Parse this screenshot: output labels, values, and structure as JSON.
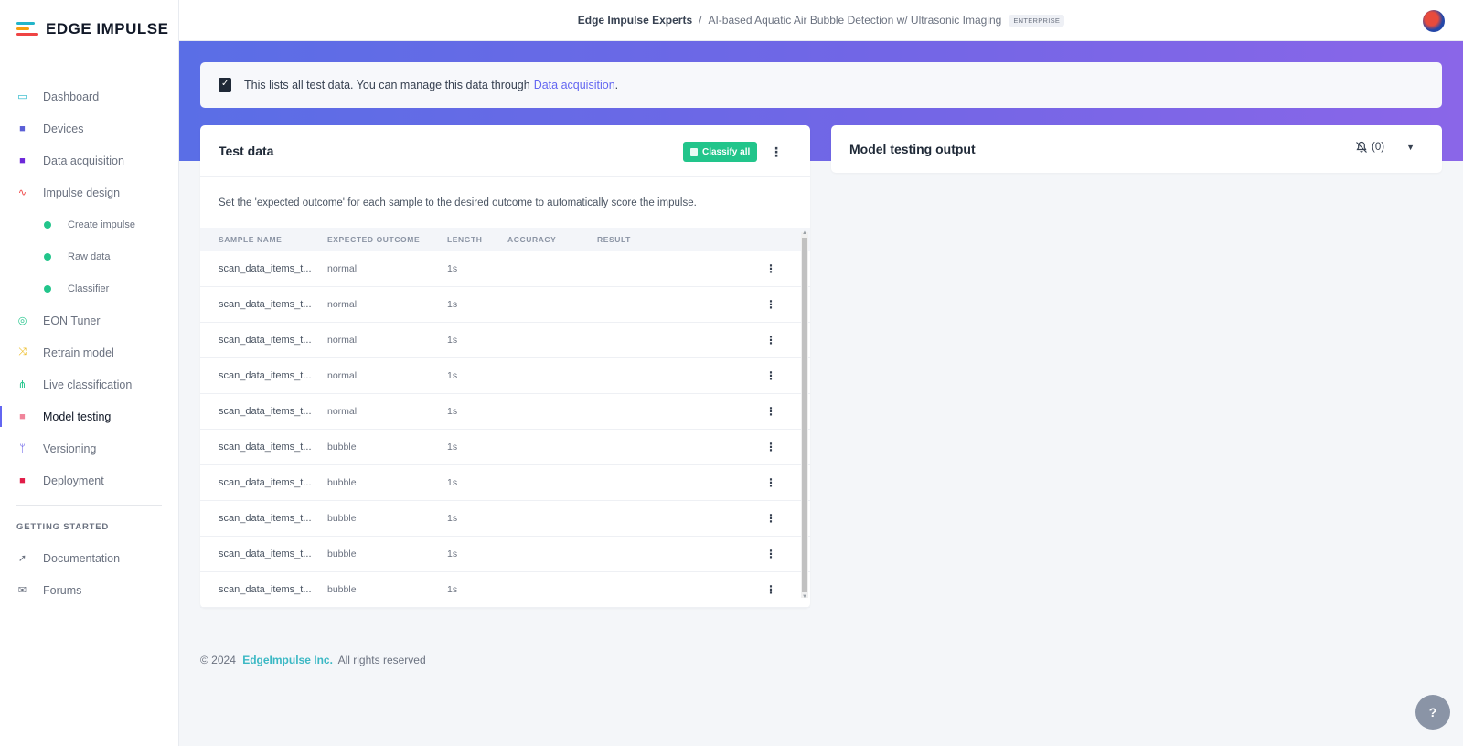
{
  "app": {
    "logo_text": "EDGE IMPULSE"
  },
  "breadcrumb": {
    "org": "Edge Impulse Experts",
    "separator": "/",
    "project": "AI-based Aquatic Air Bubble Detection w/ Ultrasonic Imaging",
    "badge": "ENTERPRISE"
  },
  "sidebar": {
    "items": [
      {
        "label": "Dashboard",
        "icon": "monitor-icon",
        "color": "#22b5c9"
      },
      {
        "label": "Devices",
        "icon": "chip-icon",
        "color": "#5b5fd6"
      },
      {
        "label": "Data acquisition",
        "icon": "database-icon",
        "color": "#6d28d9"
      },
      {
        "label": "Impulse design",
        "icon": "pulse-icon",
        "color": "#ef4444"
      }
    ],
    "sub_items": [
      {
        "label": "Create impulse"
      },
      {
        "label": "Raw data"
      },
      {
        "label": "Classifier"
      }
    ],
    "items2": [
      {
        "label": "EON Tuner",
        "icon": "compass-icon",
        "color": "#22c58b"
      },
      {
        "label": "Retrain model",
        "icon": "shuffle-icon",
        "color": "#eab308"
      },
      {
        "label": "Live classification",
        "icon": "nodes-icon",
        "color": "#22c58b"
      },
      {
        "label": "Model testing",
        "icon": "clipboard-icon",
        "color": "#f0849a",
        "active": true
      },
      {
        "label": "Versioning",
        "icon": "branch-icon",
        "color": "#4f46e5"
      },
      {
        "label": "Deployment",
        "icon": "cube-icon",
        "color": "#e11d48"
      }
    ],
    "section_title": "GETTING STARTED",
    "getting_started": [
      {
        "label": "Documentation",
        "icon": "rocket-icon"
      },
      {
        "label": "Forums",
        "icon": "chat-icon"
      }
    ]
  },
  "info": {
    "text": "This lists all test data. You can manage this data through",
    "link": "Data acquisition",
    "suffix": "."
  },
  "test_data": {
    "title": "Test data",
    "classify_label": "Classify all",
    "description": "Set the 'expected outcome' for each sample to the desired outcome to automatically score the impulse.",
    "columns": [
      "SAMPLE NAME",
      "EXPECTED OUTCOME",
      "LENGTH",
      "ACCURACY",
      "RESULT"
    ],
    "rows": [
      {
        "name": "scan_data_items_t...",
        "outcome": "normal",
        "length": "1s",
        "accuracy": "",
        "result": ""
      },
      {
        "name": "scan_data_items_t...",
        "outcome": "normal",
        "length": "1s",
        "accuracy": "",
        "result": ""
      },
      {
        "name": "scan_data_items_t...",
        "outcome": "normal",
        "length": "1s",
        "accuracy": "",
        "result": ""
      },
      {
        "name": "scan_data_items_t...",
        "outcome": "normal",
        "length": "1s",
        "accuracy": "",
        "result": ""
      },
      {
        "name": "scan_data_items_t...",
        "outcome": "normal",
        "length": "1s",
        "accuracy": "",
        "result": ""
      },
      {
        "name": "scan_data_items_t...",
        "outcome": "bubble",
        "length": "1s",
        "accuracy": "",
        "result": ""
      },
      {
        "name": "scan_data_items_t...",
        "outcome": "bubble",
        "length": "1s",
        "accuracy": "",
        "result": ""
      },
      {
        "name": "scan_data_items_t...",
        "outcome": "bubble",
        "length": "1s",
        "accuracy": "",
        "result": ""
      },
      {
        "name": "scan_data_items_t...",
        "outcome": "bubble",
        "length": "1s",
        "accuracy": "",
        "result": ""
      },
      {
        "name": "scan_data_items_t...",
        "outcome": "bubble",
        "length": "1s",
        "accuracy": "",
        "result": ""
      }
    ]
  },
  "output": {
    "title": "Model testing output",
    "notifications": "(0)"
  },
  "footer": {
    "copyright": "© 2024",
    "company": "EdgeImpulse Inc.",
    "rights": "All rights reserved"
  },
  "help": {
    "label": "?"
  }
}
